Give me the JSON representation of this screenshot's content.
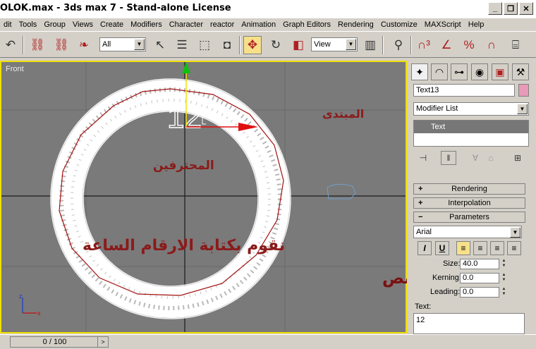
{
  "window": {
    "title": "OLOK.max - 3ds max 7  - Stand-alone License",
    "minimize_glyph": "_",
    "restore_glyph": "❐",
    "close_glyph": "✕"
  },
  "menu": [
    "dit",
    "Tools",
    "Group",
    "Views",
    "Create",
    "Modifiers",
    "Character",
    "reactor",
    "Animation",
    "Graph Editors",
    "Rendering",
    "Customize",
    "MAXScript",
    "Help"
  ],
  "toolbar": {
    "selection_filter": "All",
    "reference_coord": "View"
  },
  "viewport": {
    "label": "Front",
    "text_object_value": "12",
    "arabic_beginner": "المبتدى",
    "arabic_pro": "المحترفين",
    "arabic_clock": "نقوم بكتابة الارقام الساعة",
    "arabic_size": "حسب حجم النص",
    "axis_z": "z",
    "axis_x": "x"
  },
  "statusbar": {
    "time_slider": "0 / 100",
    "next_glyph": ">"
  },
  "command_panel": {
    "object_name": "Text13",
    "object_color": "#e89ab8",
    "modifier_list": "Modifier List",
    "stack_item": "Text",
    "rollouts": {
      "rendering": "Rendering",
      "interpolation": "Interpolation",
      "parameters": "Parameters"
    },
    "font": "Arial",
    "italic": "I",
    "underline": "U",
    "size_label": "Size:",
    "size_value": "40.0",
    "kerning_label": "Kerning:",
    "kerning_value": "0.0",
    "leading_label": "Leading:",
    "leading_value": "0.0",
    "text_label": "Text:",
    "text_value": "12"
  },
  "colors": {
    "viewport_bg": "#7a7a7a",
    "active_border": "#f0e000",
    "arabic_text": "#8b1a1a",
    "spline": "#a01010",
    "ui_face": "#d4d0c8"
  }
}
